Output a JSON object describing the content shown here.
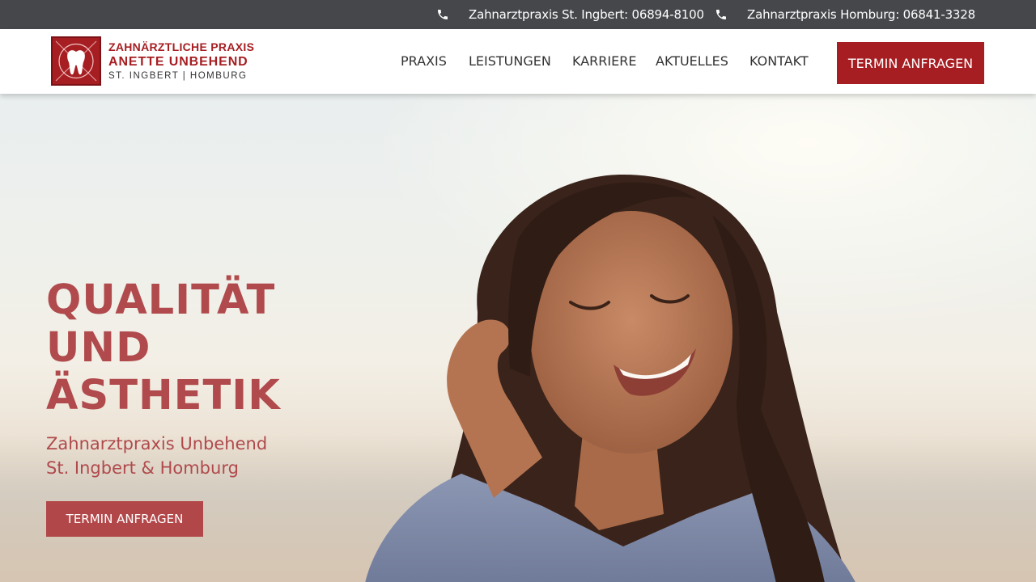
{
  "topbar": {
    "phones": [
      {
        "label": "Zahnarztpraxis St. Ingbert: 06894-8100",
        "icon": "phone-icon"
      },
      {
        "label": "Zahnarztpraxis Homburg: 06841-3328",
        "icon": "phone-icon"
      }
    ]
  },
  "logo": {
    "line1": "ZAHNÄRZTLICHE PRAXIS",
    "line2": "ANETTE UNBEHEND",
    "line3": "ST. INGBERT | HOMBURG",
    "icon": "tooth-icon"
  },
  "nav": {
    "items": [
      "PRAXIS",
      "LEISTUNGEN",
      "KARRIERE",
      "AKTUELLES",
      "KONTAKT"
    ],
    "cta": "TERMIN ANFRAGEN"
  },
  "hero": {
    "headline": [
      "QUALITÄT",
      "UND",
      "ÄSTHETIK"
    ],
    "subline": [
      "Zahnarztpraxis Unbehend",
      "St. Ingbert & Homburg"
    ],
    "cta": "TERMIN ANFRAGEN"
  },
  "colors": {
    "brand": "#a61e22",
    "hero_text": "#b04a4c",
    "topbar": "#45474b"
  }
}
